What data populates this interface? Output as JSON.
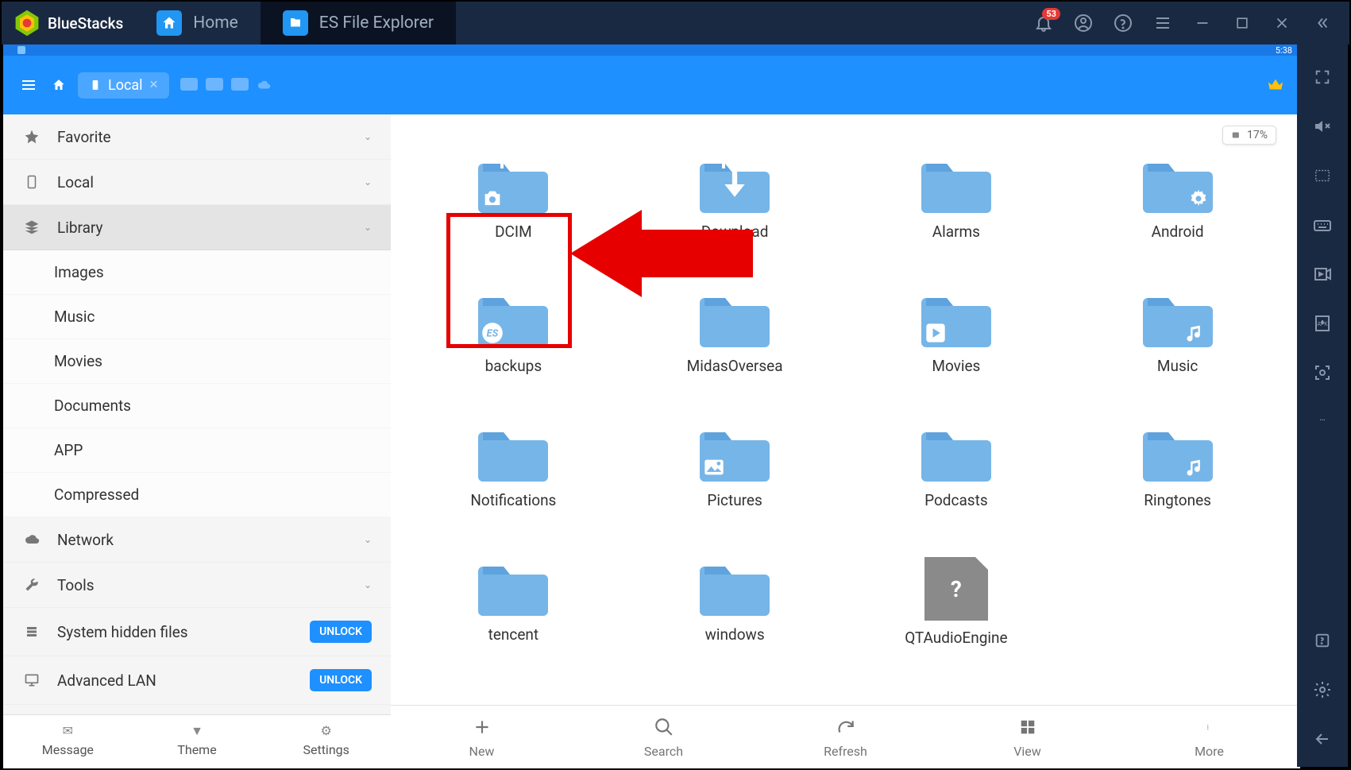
{
  "titlebar": {
    "brand": "BlueStacks",
    "tabs": [
      {
        "label": "Home",
        "icon": "home"
      },
      {
        "label": "ES File Explorer",
        "icon": "es",
        "active": true
      }
    ],
    "notification_badge": "53"
  },
  "android": {
    "status_time": "5:38",
    "header": {
      "active_tab": "Local"
    },
    "storage": {
      "text": "17%"
    },
    "sidebar": {
      "items": [
        {
          "label": "Favorite",
          "icon": "star",
          "type": "parent",
          "expandable": true
        },
        {
          "label": "Local",
          "icon": "phone",
          "type": "parent",
          "expandable": true
        },
        {
          "label": "Library",
          "icon": "stack",
          "type": "parent",
          "expandable": true,
          "expanded": true
        },
        {
          "label": "Images",
          "type": "child"
        },
        {
          "label": "Music",
          "type": "child"
        },
        {
          "label": "Movies",
          "type": "child"
        },
        {
          "label": "Documents",
          "type": "child"
        },
        {
          "label": "APP",
          "type": "child"
        },
        {
          "label": "Compressed",
          "type": "child"
        },
        {
          "label": "Network",
          "icon": "cloud",
          "type": "parent",
          "expandable": true
        },
        {
          "label": "Tools",
          "icon": "wrench",
          "type": "parent",
          "expandable": true
        },
        {
          "label": "System hidden files",
          "icon": "sys",
          "type": "parent",
          "action": "UNLOCK"
        },
        {
          "label": "Advanced LAN",
          "icon": "monitor",
          "type": "parent",
          "action": "UNLOCK"
        }
      ],
      "bottom": [
        {
          "label": "Message",
          "icon": "mail"
        },
        {
          "label": "Theme",
          "icon": "theme"
        },
        {
          "label": "Settings",
          "icon": "gear"
        }
      ]
    },
    "folders": [
      {
        "name": "DCIM",
        "overlay": "camera",
        "up": true,
        "highlight": true
      },
      {
        "name": "Download",
        "overlay": "download",
        "up": true
      },
      {
        "name": "Alarms"
      },
      {
        "name": "Android",
        "overlay": "gear-corner"
      },
      {
        "name": "backups",
        "overlay": "es-badge"
      },
      {
        "name": "MidasOversea"
      },
      {
        "name": "Movies",
        "overlay": "play"
      },
      {
        "name": "Music",
        "overlay": "music"
      },
      {
        "name": "Notifications"
      },
      {
        "name": "Pictures",
        "overlay": "picture"
      },
      {
        "name": "Podcasts"
      },
      {
        "name": "Ringtones",
        "overlay": "music"
      },
      {
        "name": "tencent"
      },
      {
        "name": "windows"
      },
      {
        "name": "QTAudioEngine",
        "icon_type": "unknown"
      }
    ],
    "bottom_bar": [
      {
        "label": "New",
        "icon": "plus"
      },
      {
        "label": "Search",
        "icon": "search"
      },
      {
        "label": "Refresh",
        "icon": "refresh"
      },
      {
        "label": "View",
        "icon": "grid"
      },
      {
        "label": "More",
        "icon": "more"
      }
    ]
  }
}
